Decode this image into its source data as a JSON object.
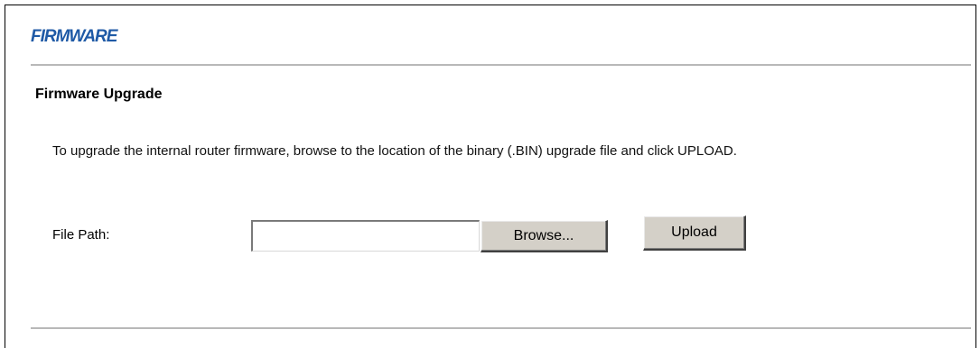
{
  "header": {
    "title": "FIRMWARE",
    "title_color": "#1f5aa6"
  },
  "section": {
    "title": "Firmware Upgrade",
    "instructions": "To upgrade the internal router firmware, browse to the location of the binary (.BIN) upgrade file and click UPLOAD."
  },
  "form": {
    "file_path_label": "File Path:",
    "file_path_value": "",
    "browse_label": "Browse...",
    "upload_label": "Upload"
  },
  "colors": {
    "rule": "#b8b8b8",
    "button_face": "#d4d0c8"
  }
}
